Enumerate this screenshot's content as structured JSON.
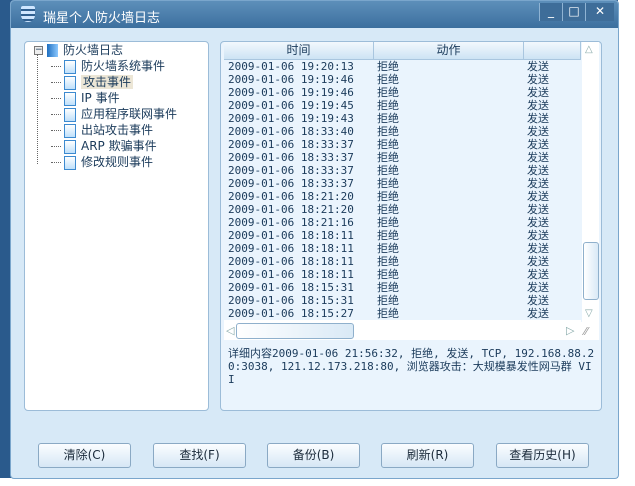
{
  "window": {
    "title": "瑞星个人防火墙日志"
  },
  "tree": {
    "root": "防火墙日志",
    "items": [
      "防火墙系统事件",
      "攻击事件",
      "IP 事件",
      "应用程序联网事件",
      "出站攻击事件",
      "ARP 欺骗事件",
      "修改规则事件"
    ],
    "selected": 1
  },
  "list": {
    "columns": [
      "时间",
      "动作",
      ""
    ],
    "rows": [
      [
        "2009-01-06 19:20:13",
        "拒绝",
        "发送"
      ],
      [
        "2009-01-06 19:19:46",
        "拒绝",
        "发送"
      ],
      [
        "2009-01-06 19:19:46",
        "拒绝",
        "发送"
      ],
      [
        "2009-01-06 19:19:45",
        "拒绝",
        "发送"
      ],
      [
        "2009-01-06 19:19:43",
        "拒绝",
        "发送"
      ],
      [
        "2009-01-06 18:33:40",
        "拒绝",
        "发送"
      ],
      [
        "2009-01-06 18:33:37",
        "拒绝",
        "发送"
      ],
      [
        "2009-01-06 18:33:37",
        "拒绝",
        "发送"
      ],
      [
        "2009-01-06 18:33:37",
        "拒绝",
        "发送"
      ],
      [
        "2009-01-06 18:33:37",
        "拒绝",
        "发送"
      ],
      [
        "2009-01-06 18:21:20",
        "拒绝",
        "发送"
      ],
      [
        "2009-01-06 18:21:20",
        "拒绝",
        "发送"
      ],
      [
        "2009-01-06 18:21:16",
        "拒绝",
        "发送"
      ],
      [
        "2009-01-06 18:18:11",
        "拒绝",
        "发送"
      ],
      [
        "2009-01-06 18:18:11",
        "拒绝",
        "发送"
      ],
      [
        "2009-01-06 18:18:11",
        "拒绝",
        "发送"
      ],
      [
        "2009-01-06 18:18:11",
        "拒绝",
        "发送"
      ],
      [
        "2009-01-06 18:15:31",
        "拒绝",
        "发送"
      ],
      [
        "2009-01-06 18:15:31",
        "拒绝",
        "发送"
      ],
      [
        "2009-01-06 18:15:27",
        "拒绝",
        "发送"
      ]
    ]
  },
  "detail": "详细内容2009-01-06 21:56:32, 拒绝, 发送, TCP, 192.168.88.20:3038, 121.12.173.218:80, 浏览器攻击：大规模暴发性网马群 VII",
  "buttons": [
    "清除(C)",
    "查找(F)",
    "备份(B)",
    "刷新(R)",
    "查看历史(H)"
  ]
}
